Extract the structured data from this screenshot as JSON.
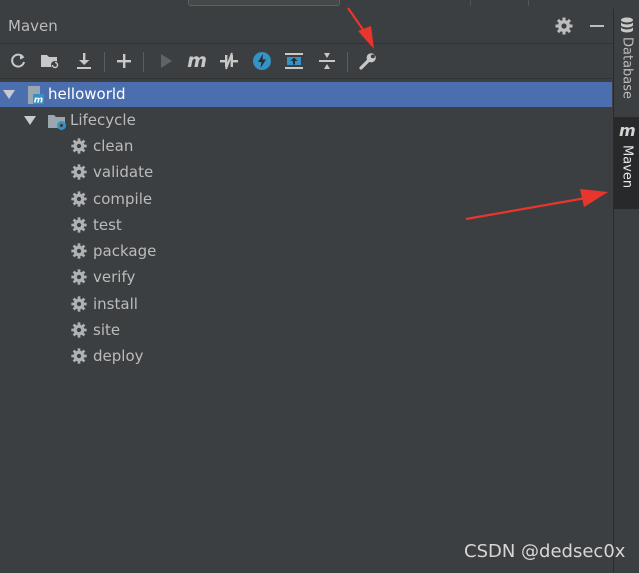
{
  "panel": {
    "title": "Maven",
    "settings_icon": "gear-icon",
    "minimize_icon": "minimize-icon"
  },
  "toolbar": {
    "buttons": [
      {
        "name": "reload-all-projects-button",
        "icon": "refresh-icon"
      },
      {
        "name": "generate-sources-button",
        "icon": "folder-refresh-icon"
      },
      {
        "name": "download-sources-button",
        "icon": "download-icon"
      },
      {
        "name": "add-maven-project-button",
        "icon": "plus-icon"
      },
      {
        "name": "run-maven-build-button",
        "icon": "play-icon"
      },
      {
        "name": "execute-maven-goal-button",
        "icon": "maven-m-icon",
        "label": "m"
      },
      {
        "name": "toggle-offline-mode-button",
        "icon": "offline-icon"
      },
      {
        "name": "toggle-skip-tests-button",
        "icon": "lightning-icon"
      },
      {
        "name": "show-dependencies-button",
        "icon": "dependencies-icon"
      },
      {
        "name": "collapse-all-button",
        "icon": "collapse-icon"
      },
      {
        "name": "maven-settings-button",
        "icon": "wrench-icon"
      }
    ]
  },
  "tree": {
    "project": "helloworld",
    "lifecycle": "Lifecycle",
    "goals": [
      "clean",
      "validate",
      "compile",
      "test",
      "package",
      "verify",
      "install",
      "site",
      "deploy"
    ]
  },
  "right_sidebar": {
    "tabs": [
      {
        "label": "Database",
        "icon": "database-icon",
        "active": false
      },
      {
        "label": "Maven",
        "icon": "maven-m-icon",
        "icon_label": "m",
        "active": true
      }
    ]
  },
  "annotations": {
    "arrow_color": "#e8352e"
  },
  "watermark": "CSDN @dedsec0x",
  "colors": {
    "panel_bg": "#3c3f41",
    "selection": "#4b6eaf",
    "text": "#bbbbbb",
    "icon_blue": "#3592c4"
  }
}
